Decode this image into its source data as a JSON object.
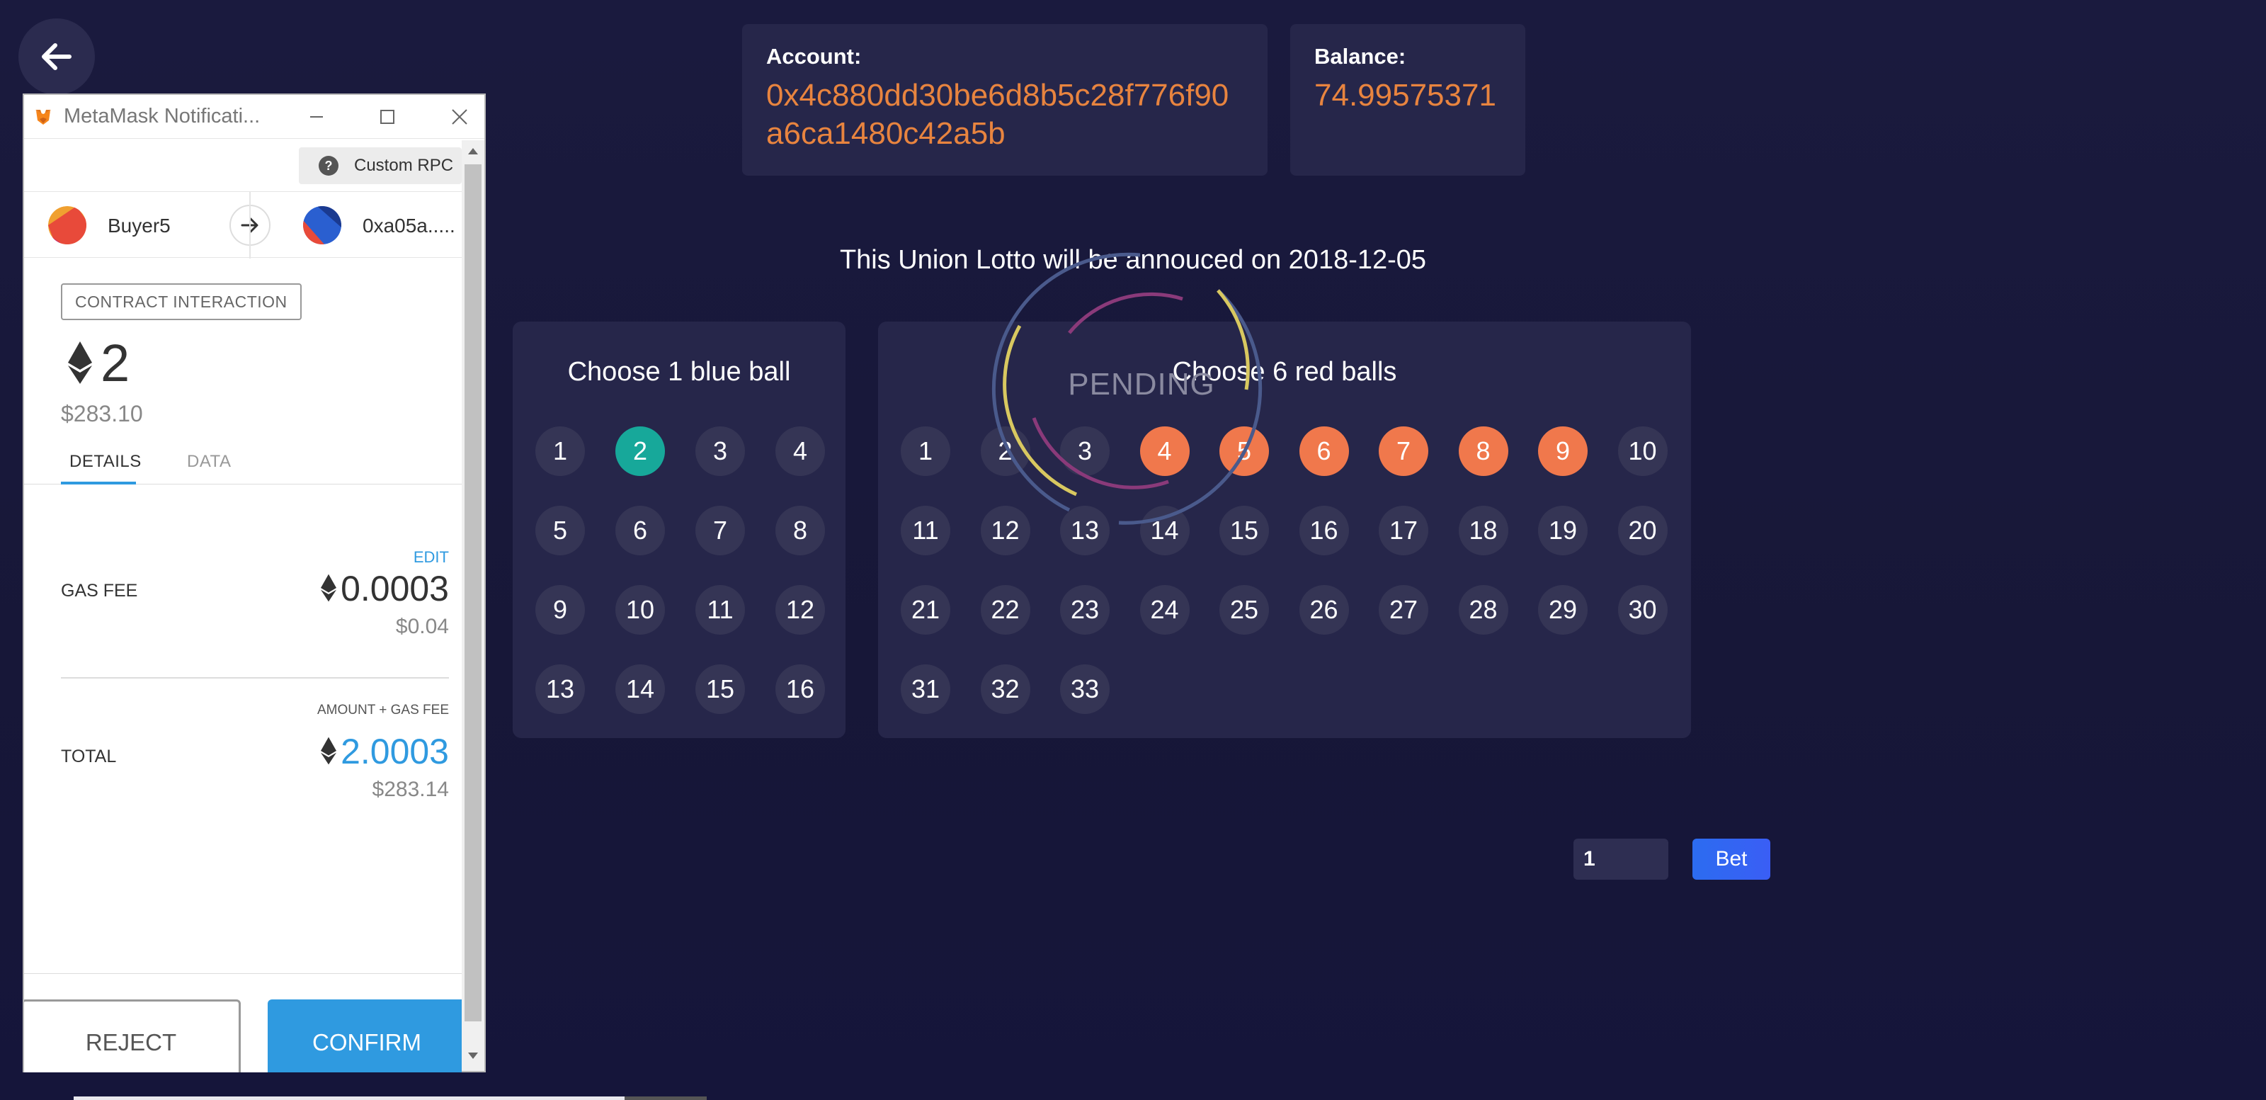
{
  "nav": {
    "back_icon": "arrow-left-icon"
  },
  "account": {
    "label": "Account:",
    "value": "0x4c880dd30be6d8b5c28f776f90a6ca1480c42a5b"
  },
  "balance": {
    "label": "Balance:",
    "value": "74.99575371"
  },
  "announcement": "This Union Lotto will be annouced on 2018-12-05",
  "blue_panel": {
    "title": "Choose 1 blue ball",
    "balls": [
      "1",
      "2",
      "3",
      "4",
      "5",
      "6",
      "7",
      "8",
      "9",
      "10",
      "11",
      "12",
      "13",
      "14",
      "15",
      "16"
    ],
    "selected": [
      "2"
    ]
  },
  "red_panel": {
    "title": "Choose 6 red balls",
    "balls": [
      "1",
      "2",
      "3",
      "4",
      "5",
      "6",
      "7",
      "8",
      "9",
      "10",
      "11",
      "12",
      "13",
      "14",
      "15",
      "16",
      "17",
      "18",
      "19",
      "20",
      "21",
      "22",
      "23",
      "24",
      "25",
      "26",
      "27",
      "28",
      "29",
      "30",
      "31",
      "32",
      "33"
    ],
    "selected": [
      "4",
      "5",
      "6",
      "7",
      "8",
      "9"
    ]
  },
  "pending": {
    "text": "PENDING"
  },
  "bet": {
    "multiplier_value": "1",
    "button_label": "Bet"
  },
  "colors": {
    "background": "#1a1a3e",
    "card": "#26264a",
    "accent_orange": "#e8843f",
    "blue_selected": "#17a89a",
    "red_selected": "#f0784c",
    "bet_button": "#2c6cf0",
    "metamask_blue": "#2f9ae0"
  },
  "metamask": {
    "window_title": "MetaMask Notificati...",
    "network": "Custom RPC",
    "from_account": "Buyer5",
    "to_account": "0xa05a.....",
    "badge": "CONTRACT INTERACTION",
    "amount_eth": "2",
    "amount_usd": "$283.10",
    "tabs": {
      "details": "DETAILS",
      "data": "DATA"
    },
    "edit_label": "EDIT",
    "gas_fee": {
      "label": "GAS FEE",
      "eth": "0.0003",
      "usd": "$0.04"
    },
    "total": {
      "caption": "AMOUNT + GAS FEE",
      "label": "TOTAL",
      "eth": "2.0003",
      "usd": "$283.14"
    },
    "reject_label": "REJECT",
    "confirm_label": "CONFIRM"
  }
}
